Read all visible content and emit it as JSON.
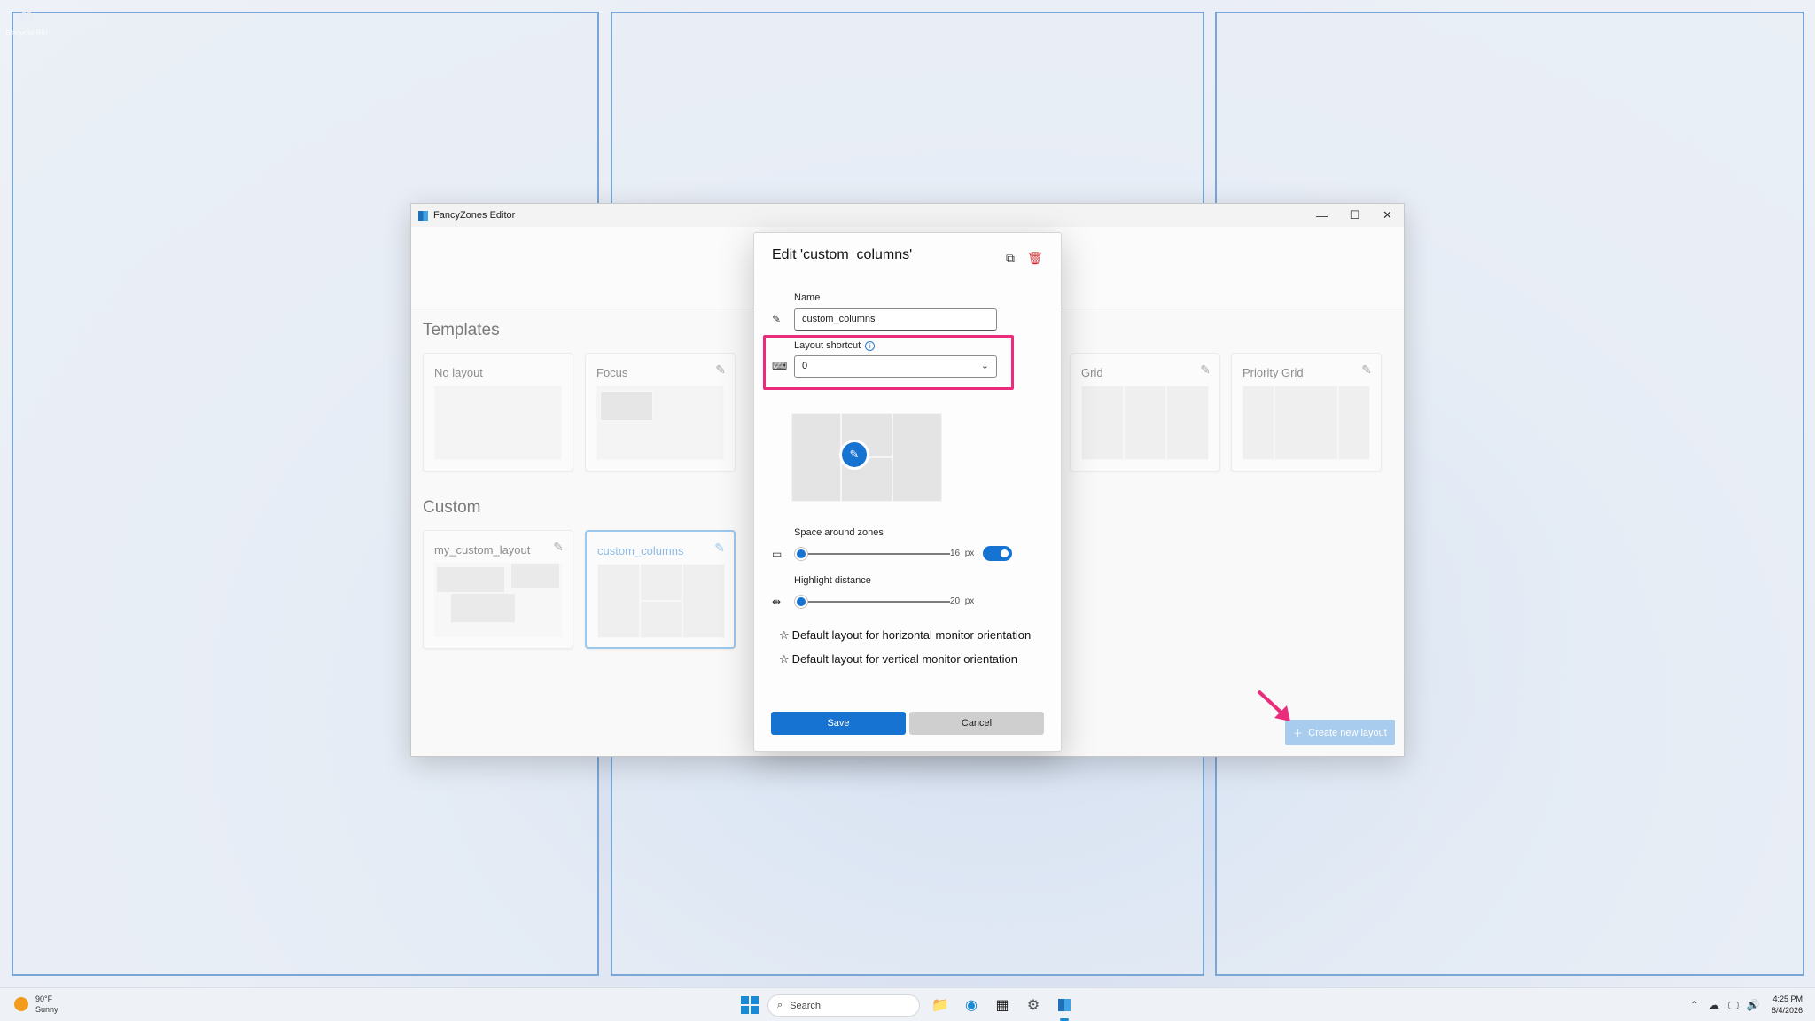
{
  "desktop": {
    "icon_label": "Recycle Bin"
  },
  "window": {
    "title": "FancyZones Editor",
    "minimize_glyph": "—",
    "maximize_glyph": "☐",
    "close_glyph": "✕"
  },
  "sections": {
    "templates_title": "Templates",
    "custom_title": "Custom"
  },
  "templates": [
    {
      "name": "No layout",
      "editable": false
    },
    {
      "name": "Focus",
      "editable": true
    },
    {
      "name": "Grid",
      "editable": true
    },
    {
      "name": "Priority Grid",
      "editable": true
    }
  ],
  "custom_layouts": [
    {
      "name": "my_custom_layout",
      "selected": false
    },
    {
      "name": "custom_columns",
      "selected": true
    }
  ],
  "create_button": {
    "icon": "plus-icon",
    "label": "Create new layout"
  },
  "dialog": {
    "title": "Edit 'custom_columns'",
    "name_label": "Name",
    "name_value": "custom_columns",
    "shortcut_label": "Layout shortcut",
    "shortcut_value": "0",
    "space_label": "Space around zones",
    "space_value": "16",
    "space_unit": "px",
    "space_toggle_on": true,
    "highlight_label": "Highlight distance",
    "highlight_value": "20",
    "highlight_unit": "px",
    "default_horizontal": "Default layout for horizontal monitor orientation",
    "default_vertical": "Default layout for vertical monitor orientation",
    "save_label": "Save",
    "cancel_label": "Cancel"
  },
  "taskbar": {
    "weather_temp": "90°F",
    "weather_desc": "Sunny",
    "search_placeholder": "Search",
    "time": "4:25 PM",
    "date": "8/4/2026"
  },
  "colors": {
    "accent": "#1673d1",
    "highlight_annotation": "#ea2c7c",
    "zone_border": "#7aa6d6",
    "delete_red": "#d13438"
  }
}
